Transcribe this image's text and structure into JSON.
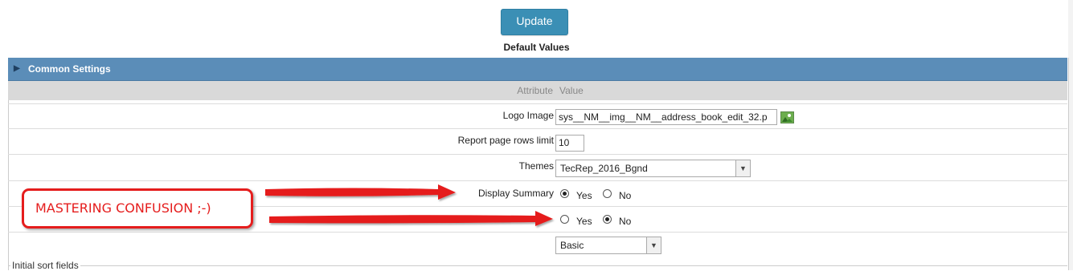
{
  "toolbar": {
    "update_label": "Update"
  },
  "section": {
    "title": "Default Values"
  },
  "panel": {
    "title": "Common Settings",
    "collapse_icon": "triangle-right-icon"
  },
  "table": {
    "attribute_header": "Attribute",
    "value_header": "Value"
  },
  "rows": {
    "logo": {
      "label": "Logo Image",
      "value": "sys__NM__img__NM__address_book_edit_32.p",
      "icon": "image-icon"
    },
    "rows_limit": {
      "label": "Report page rows limit",
      "value": "10"
    },
    "themes": {
      "label": "Themes",
      "selected": "TecRep_2016_Bgnd"
    },
    "display_summary": {
      "label": "Display Summary",
      "yes": "Yes",
      "no": "No",
      "selected": "Yes"
    },
    "unlabeled_toggle": {
      "yes": "Yes",
      "no": "No",
      "selected": "No"
    },
    "mode": {
      "selected": "Basic"
    }
  },
  "annotation": {
    "text": "MASTERING CONFUSION ;-)",
    "color": "#e51d1d"
  },
  "fieldset": {
    "legend": "Initial sort fields"
  },
  "colors": {
    "accent": "#3b8fb5",
    "panel_header": "#5b8db8",
    "callout": "#e51d1d"
  }
}
